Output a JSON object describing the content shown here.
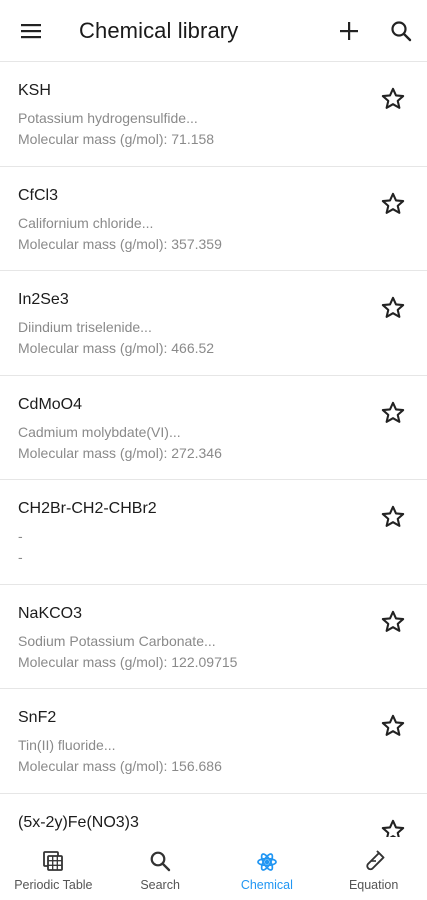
{
  "header": {
    "title": "Chemical library",
    "menu_icon": "hamburger-menu-icon",
    "add_icon": "plus-icon",
    "search_icon": "search-icon"
  },
  "chemicals": [
    {
      "formula": "KSH",
      "name": "Potassium hydrogensulfide...",
      "mass": "Molecular mass (g/mol): 71.158"
    },
    {
      "formula": "CfCl3",
      "name": "Californium chloride...",
      "mass": "Molecular mass (g/mol): 357.359"
    },
    {
      "formula": "In2Se3",
      "name": "Diindium triselenide...",
      "mass": "Molecular mass (g/mol): 466.52"
    },
    {
      "formula": "CdMoO4",
      "name": "Cadmium molybdate(VI)...",
      "mass": "Molecular mass (g/mol): 272.346"
    },
    {
      "formula": "CH2Br-CH2-CHBr2",
      "name": "-",
      "mass": "-"
    },
    {
      "formula": "NaKCO3",
      "name": "Sodium Potassium Carbonate...",
      "mass": "Molecular mass (g/mol): 122.09715"
    },
    {
      "formula": "SnF2",
      "name": "Tin(II) fluoride...",
      "mass": "Molecular mass (g/mol): 156.686"
    },
    {
      "formula": "(5x-2y)Fe(NO3)3",
      "name": "",
      "mass": ""
    }
  ],
  "nav": [
    {
      "label": "Periodic Table",
      "icon": "periodic-table-icon",
      "active": false
    },
    {
      "label": "Search",
      "icon": "search-icon",
      "active": false
    },
    {
      "label": "Chemical",
      "icon": "atom-icon",
      "active": true
    },
    {
      "label": "Equation",
      "icon": "test-tube-icon",
      "active": false
    }
  ],
  "colors": {
    "accent": "#2196f3",
    "text_primary": "#1c1c1c",
    "text_secondary": "#8a8a8a",
    "divider": "#e6e6e6"
  }
}
